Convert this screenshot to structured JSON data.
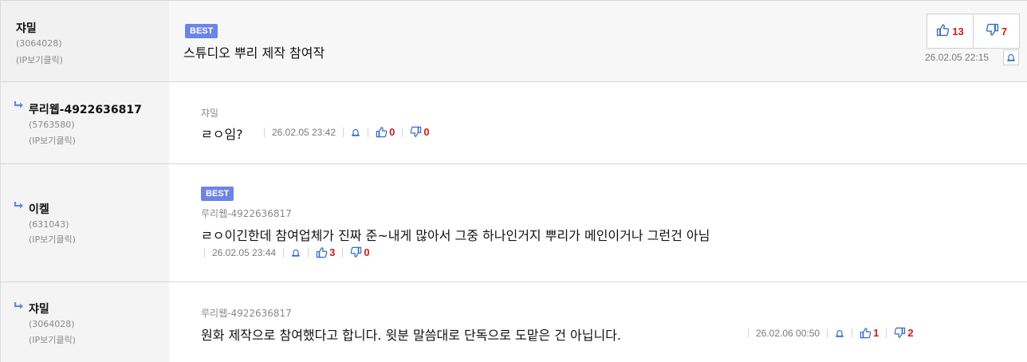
{
  "colors": {
    "accent": "#6c84e6",
    "count": "#d11a1a",
    "icon": "#2f6cc9"
  },
  "post": {
    "nick": "쟈밀",
    "uid": "(3064028)",
    "ip": "(IP보기클릭)",
    "badge": "BEST",
    "title": "스튜디오 뿌리 제작 참여작",
    "up": "13",
    "down": "7",
    "date": "26.02.05 22:15"
  },
  "comments": [
    {
      "nick": "루리웹-4922636817",
      "uid": "(5763580)",
      "ip": "(IP보기클릭)",
      "reply_to": "쟈밀",
      "text": "ㄹㅇ임?",
      "date": "26.02.05 23:42",
      "up": "0",
      "down": "0"
    },
    {
      "nick": "이켈",
      "uid": "(631043)",
      "ip": "(IP보기클릭)",
      "badge": "BEST",
      "reply_to": "루리웹-4922636817",
      "text": "ㄹㅇ이긴한데 참여업체가 진짜 준~내게 많아서 그중 하나인거지 뿌리가 메인이거나 그런건 아님",
      "date": "26.02.05 23:44",
      "up": "3",
      "down": "0"
    },
    {
      "nick": "쟈밀",
      "uid": "(3064028)",
      "ip": "(IP보기클릭)",
      "reply_to": "루리웹-4922636817",
      "text": "원화 제작으로 참여했다고 합니다. 윗분 말씀대로 단독으로 도맡은 건 아닙니다.",
      "date": "26.02.06 00:50",
      "up": "1",
      "down": "2"
    }
  ]
}
